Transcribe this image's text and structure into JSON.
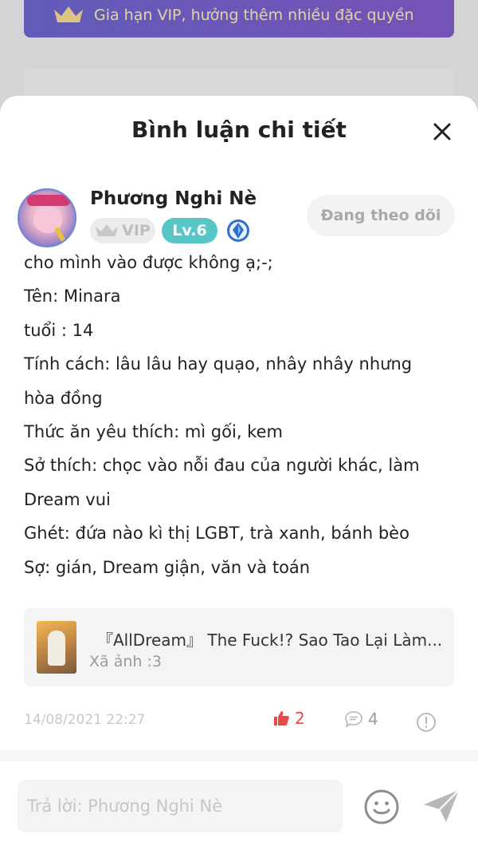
{
  "background": {
    "vip_banner_text": "Gia hạn VIP, hưởng thêm nhiều đặc quyền"
  },
  "sheet": {
    "title": "Bình luận chi tiết"
  },
  "comment": {
    "username": "Phương Nghi Nè",
    "vip_label": "VIP",
    "level_label": "Lv.6",
    "follow_label": "Đang theo dõi",
    "lines": [
      "cho mình vào được không ạ;-;",
      "Tên: Minara",
      "tuổi : 14",
      "Tính cách: lâu lâu hay quạo, nhây nhây nhưng",
      "hòa đồng",
      "Thức ăn yêu thích: mì gối, kem",
      "Sở thích: chọc vào nỗi đau của người khác, làm",
      "Dream vui",
      "Ghét: đứa nào kì thị LGBT, trà xanh, bánh bèo",
      "Sợ: gián, Dream giận, văn và toán"
    ],
    "linked_story": {
      "title": "『AllDream』 The Fuck!? Sao Tao Lại Làm...",
      "subtitle": "Xã ảnh :3"
    },
    "timestamp": "14/08/2021 22:27",
    "like_count": "2",
    "reply_count": "4"
  },
  "reply_bar": {
    "placeholder": "Trả lời: Phương Nghi Nè"
  },
  "colors": {
    "accent_like": "#e84a4a",
    "level_badge": "#58c6c7",
    "vip_banner": "#6a63c9"
  },
  "icons": [
    "crown-icon",
    "close-icon",
    "vip-crown-icon",
    "diamond-rank-icon",
    "thumbs-up-icon",
    "comment-icon",
    "report-icon",
    "emoji-icon",
    "send-icon"
  ]
}
